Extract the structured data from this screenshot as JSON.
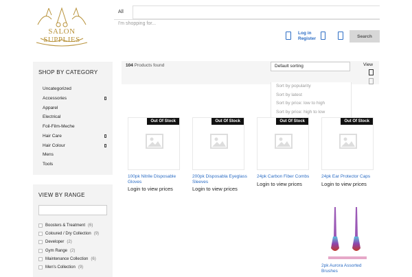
{
  "header": {
    "logo_text": "SALON SUPPLIES",
    "category_select": "All",
    "search_placeholder": "I'm shopping for...",
    "login_label": "Log in",
    "register_label": "Register",
    "search_button": "Search"
  },
  "sidebar": {
    "categories_title": "SHOP BY CATEGORY",
    "categories": [
      {
        "label": "Uncategorized",
        "expandable": false
      },
      {
        "label": "Accessories",
        "expandable": true
      },
      {
        "label": "Apparel",
        "expandable": false
      },
      {
        "label": "Electrical",
        "expandable": false
      },
      {
        "label": "Foil-Film-Meche",
        "expandable": false
      },
      {
        "label": "Hair Care",
        "expandable": true
      },
      {
        "label": "Hair Colour",
        "expandable": true
      },
      {
        "label": "Mens",
        "expandable": false
      },
      {
        "label": "Tools",
        "expandable": false
      }
    ],
    "range_title": "VIEW BY RANGE",
    "ranges": [
      {
        "label": "Boosters & Treatment",
        "count": "(6)"
      },
      {
        "label": "Coloured / Dry Collection",
        "count": "(9)"
      },
      {
        "label": "Developer",
        "count": "(2)"
      },
      {
        "label": "Gym Range",
        "count": "(2)"
      },
      {
        "label": "Maintenance Collection",
        "count": "(6)"
      },
      {
        "label": "Men's Collection",
        "count": "(9)"
      }
    ]
  },
  "toolbar": {
    "count": "104",
    "found_label": "Products found",
    "sort_selected": "Default sorting",
    "sort_options": [
      "Sort by popularity",
      "Sort by latest",
      "Sort by price: low to high",
      "Sort by price: high to low"
    ],
    "view_label": "View"
  },
  "products": [
    {
      "name": "100pk Nitrile Disposable Gloves",
      "badge": "Out Of Stock",
      "price": "Login to view prices"
    },
    {
      "name": "200pk Disposabla Eyeglass Sleeves",
      "badge": "Out Of Stock",
      "price": "Login to view prices"
    },
    {
      "name": "24pk Carbon Fiber Combs",
      "badge": "Out Of Stock",
      "price": "Login to view prices"
    },
    {
      "name": "24pk Ear Protector Caps",
      "badge": "Out Of Stock",
      "price": "Login to view prices"
    }
  ],
  "featured_product": {
    "name": "2pk Aurora Assorted Brushes"
  },
  "colors": {
    "accent": "#2b6cc4",
    "badge_bg": "#111111",
    "gold": "#b8923a",
    "sidebar_bg": "#f3f3f3"
  }
}
